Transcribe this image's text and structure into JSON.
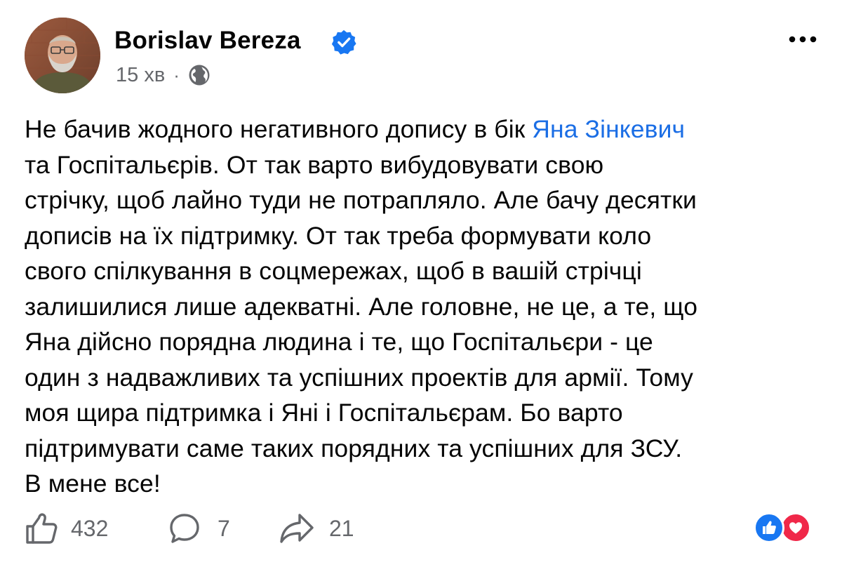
{
  "post": {
    "author": {
      "name": "Borislav Bereza",
      "verified": true
    },
    "time": "15 хв",
    "separator": "·",
    "audience_icon": "globe-icon",
    "menu_icon": "more-horizontal-icon",
    "body": {
      "lines": [
        {
          "pre": "Не бачив жодного негативного допису в бік ",
          "mention": "Яна Зінкевич"
        },
        {
          "text": "та Госпітальєрів. От так варто вибудовувати свою"
        },
        {
          "text": "стрічку, щоб лайно туди не потрапляло. Але бачу десятки"
        },
        {
          "text": "дописів на їх підтримку. От так треба формувати коло"
        },
        {
          "text": "свого спілкування в соцмережах, щоб в вашій стрічці"
        },
        {
          "text": "залишилися лише адекватні. Але головне, не це, а те, що"
        },
        {
          "text": "Яна дійсно порядна людина і те, що Госпітальєри - це"
        },
        {
          "text": "один з надважливих та успішних проектів для армії. Тому"
        },
        {
          "text": "моя щира підтримка і Яні і Госпітальєрам. Бо варто"
        },
        {
          "text": "підтримувати саме таких порядних та успішних для ЗСУ."
        },
        {
          "text": "В мене все!"
        }
      ]
    },
    "stats": {
      "likes": "432",
      "comments": "7",
      "shares": "21"
    },
    "reactions": [
      "like",
      "love"
    ],
    "colors": {
      "mention": "#1b6ee5",
      "verified": "#1877f2",
      "like_reaction": "#1877f2",
      "love_reaction": "#f02849",
      "secondary_text": "#65676b"
    }
  }
}
